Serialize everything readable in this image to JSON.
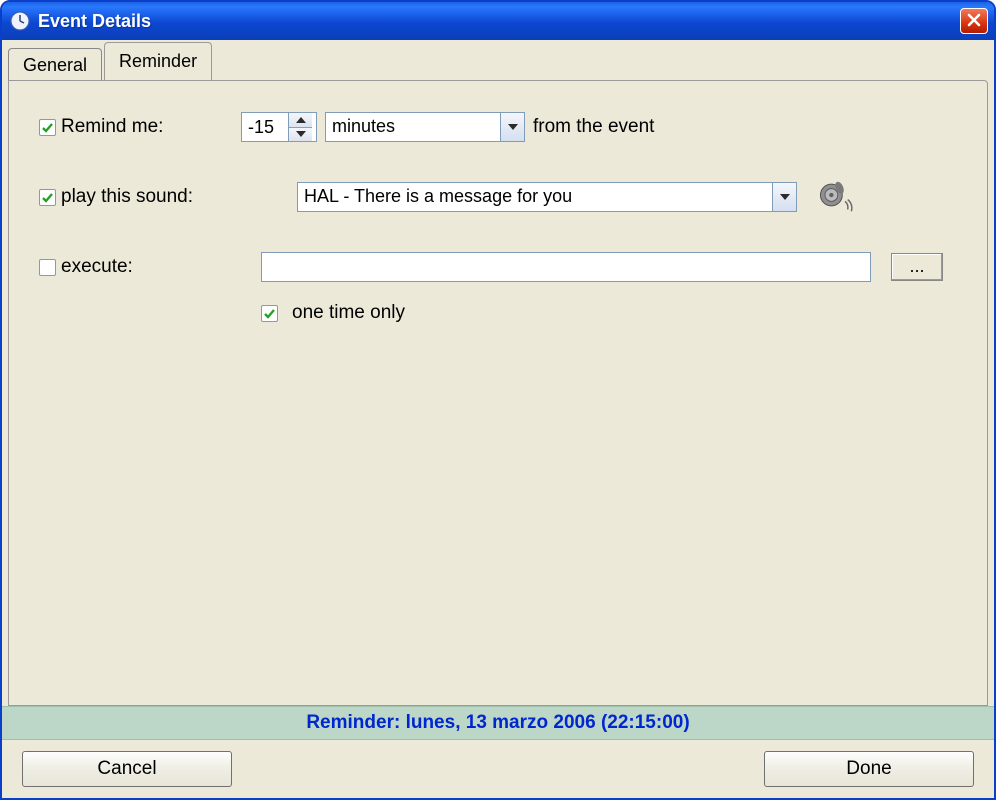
{
  "window": {
    "title": "Event Details"
  },
  "tabs": {
    "general": "General",
    "reminder": "Reminder"
  },
  "form": {
    "remind_label": "Remind me:",
    "remind_value": "-15",
    "remind_unit": "minutes",
    "remind_suffix": "from the event",
    "sound_label": "play this sound:",
    "sound_value": "HAL - There is a message for you",
    "execute_label": "execute:",
    "execute_value": "",
    "browse_label": "...",
    "onetime_label": "one time only"
  },
  "status": {
    "text": "Reminder: lunes, 13 marzo 2006 (22:15:00)"
  },
  "buttons": {
    "cancel": "Cancel",
    "done": "Done"
  }
}
